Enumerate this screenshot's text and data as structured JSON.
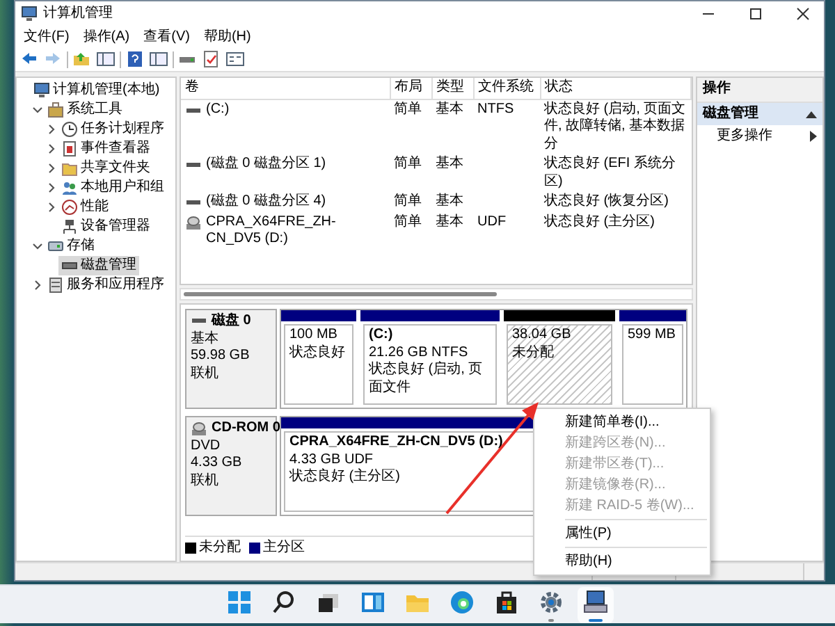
{
  "window": {
    "title": "计算机管理"
  },
  "menu": [
    "文件(F)",
    "操作(A)",
    "查看(V)",
    "帮助(H)"
  ],
  "toolbar": [
    {
      "kind": "back",
      "disabled": false
    },
    {
      "kind": "forward",
      "disabled": true
    },
    {
      "kind": "separator"
    },
    {
      "kind": "up",
      "disabled": false
    },
    {
      "kind": "pane",
      "disabled": false
    },
    {
      "kind": "separator"
    },
    {
      "kind": "help",
      "disabled": false
    },
    {
      "kind": "pane",
      "disabled": false
    },
    {
      "kind": "separator"
    },
    {
      "kind": "drive",
      "disabled": false
    },
    {
      "kind": "check",
      "disabled": false
    },
    {
      "kind": "dialog",
      "disabled": false
    }
  ],
  "tree": [
    {
      "label": "计算机管理(本地)",
      "kind": "computer",
      "selected": false,
      "children": [
        {
          "label": "系统工具",
          "kind": "tools",
          "expanded": true,
          "selected": false,
          "children": [
            {
              "label": "任务计划程序",
              "kind": "clock",
              "expanded": false,
              "selected": false
            },
            {
              "label": "事件查看器",
              "kind": "log",
              "expanded": false,
              "selected": false
            },
            {
              "label": "共享文件夹",
              "kind": "folder",
              "expanded": false,
              "selected": false
            },
            {
              "label": "本地用户和组",
              "kind": "users",
              "expanded": false,
              "selected": false
            },
            {
              "label": "性能",
              "kind": "perf",
              "expanded": false,
              "selected": false
            },
            {
              "label": "设备管理器",
              "kind": "device",
              "selected": false
            }
          ]
        },
        {
          "label": "存储",
          "kind": "storage",
          "expanded": true,
          "selected": false,
          "children": [
            {
              "label": "磁盘管理",
              "kind": "disk",
              "selected": true
            }
          ]
        },
        {
          "label": "服务和应用程序",
          "kind": "services",
          "expanded": false,
          "selected": false
        }
      ]
    }
  ],
  "table": {
    "columns": [
      "卷",
      "布局",
      "类型",
      "文件系统",
      "状态"
    ],
    "rows": [
      {
        "kind": "drive",
        "volume": "(C:)",
        "layout": "简单",
        "type": "基本",
        "filesystem": "NTFS",
        "status": "状态良好 (启动, 页面文件, 故障转储, 基本数据分"
      },
      {
        "kind": "drive",
        "volume": "(磁盘 0 磁盘分区 1)",
        "layout": "简单",
        "type": "基本",
        "status": "状态良好 (EFI 系统分区)"
      },
      {
        "kind": "drive",
        "volume": "(磁盘 0 磁盘分区 4)",
        "layout": "简单",
        "type": "基本",
        "status": "状态良好 (恢复分区)"
      },
      {
        "kind": "cdrom",
        "volume": "CPRA_X64FRE_ZH-CN_DV5 (D:)",
        "layout": "简单",
        "type": "基本",
        "filesystem": "UDF",
        "status": "状态良好 (主分区)"
      }
    ]
  },
  "disks": [
    {
      "name": "磁盘 0",
      "kind": "hdd",
      "lines": [
        "基本",
        "59.98 GB",
        "联机"
      ],
      "partitions": [
        {
          "kind": "primary",
          "size": "100 MB",
          "status": "状态良好"
        },
        {
          "kind": "primary",
          "title": "(C:)",
          "size": "21.26 GB NTFS",
          "status": "状态良好 (启动, 页面文件"
        },
        {
          "kind": "unallocated",
          "size": "38.04 GB",
          "status": "未分配"
        },
        {
          "kind": "primary",
          "size": "599 MB"
        }
      ]
    },
    {
      "name": "CD-ROM 0",
      "kind": "cdrom",
      "lines": [
        "DVD",
        "4.33 GB",
        "联机"
      ],
      "partitions": [
        {
          "kind": "primary",
          "title": "CPRA_X64FRE_ZH-CN_DV5  (D:)",
          "size": "4.33 GB UDF",
          "status": "状态良好 (主分区)"
        }
      ]
    }
  ],
  "legend": [
    {
      "label": "未分配",
      "color": "#000000"
    },
    {
      "label": "主分区",
      "color": "#000080"
    }
  ],
  "context_menu": [
    {
      "kind": "item",
      "label": "新建简单卷(I)...",
      "disabled": false
    },
    {
      "kind": "item",
      "label": "新建跨区卷(N)...",
      "disabled": true
    },
    {
      "kind": "item",
      "label": "新建带区卷(T)...",
      "disabled": true
    },
    {
      "kind": "item",
      "label": "新建镜像卷(R)...",
      "disabled": true
    },
    {
      "kind": "item",
      "label": "新建 RAID-5 卷(W)...",
      "disabled": true
    },
    {
      "kind": "separator"
    },
    {
      "kind": "item",
      "label": "属性(P)",
      "disabled": false
    },
    {
      "kind": "separator"
    },
    {
      "kind": "item",
      "label": "帮助(H)",
      "disabled": false
    }
  ],
  "actions": {
    "header": "操作",
    "section": "磁盘管理",
    "expanded": true,
    "items": [
      "更多操作"
    ]
  },
  "taskbar": [
    {
      "kind": "start",
      "running": false,
      "active": false
    },
    {
      "kind": "search",
      "running": false,
      "active": false
    },
    {
      "kind": "taskview",
      "running": false,
      "active": false
    },
    {
      "kind": "widgets",
      "running": false,
      "active": false
    },
    {
      "kind": "explorer",
      "running": false,
      "active": false
    },
    {
      "kind": "browser",
      "running": false,
      "active": false
    },
    {
      "kind": "store",
      "running": false,
      "active": false
    },
    {
      "kind": "settings",
      "running": true,
      "active": false
    },
    {
      "kind": "compmgmt",
      "running": true,
      "active": true
    }
  ]
}
